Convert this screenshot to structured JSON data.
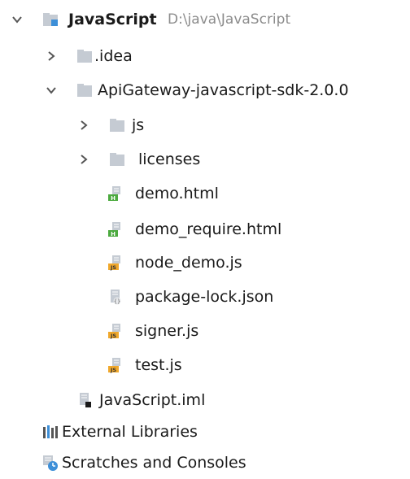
{
  "tree": {
    "root": {
      "name": "JavaScript",
      "path": "D:\\java\\JavaScript"
    },
    "idea": {
      "name": ".idea"
    },
    "sdk": {
      "name": "ApiGateway-javascript-sdk-2.0.0"
    },
    "js_folder": {
      "name": "js"
    },
    "licenses": {
      "name": "licenses"
    },
    "files": {
      "demo_html": "demo.html",
      "demo_require": "demo_require.html",
      "node_demo": "node_demo.js",
      "package_lock": "package-lock.json",
      "signer": "signer.js",
      "test": "test.js"
    },
    "iml": "JavaScript.iml",
    "external_libraries": "External Libraries",
    "scratches": "Scratches and Consoles"
  },
  "colors": {
    "folder": "#c5cbd3",
    "module_blue": "#3d8fd8",
    "html_badge": "#4caa3f",
    "js_badge": "#f0a82c",
    "chevron": "#555555"
  }
}
